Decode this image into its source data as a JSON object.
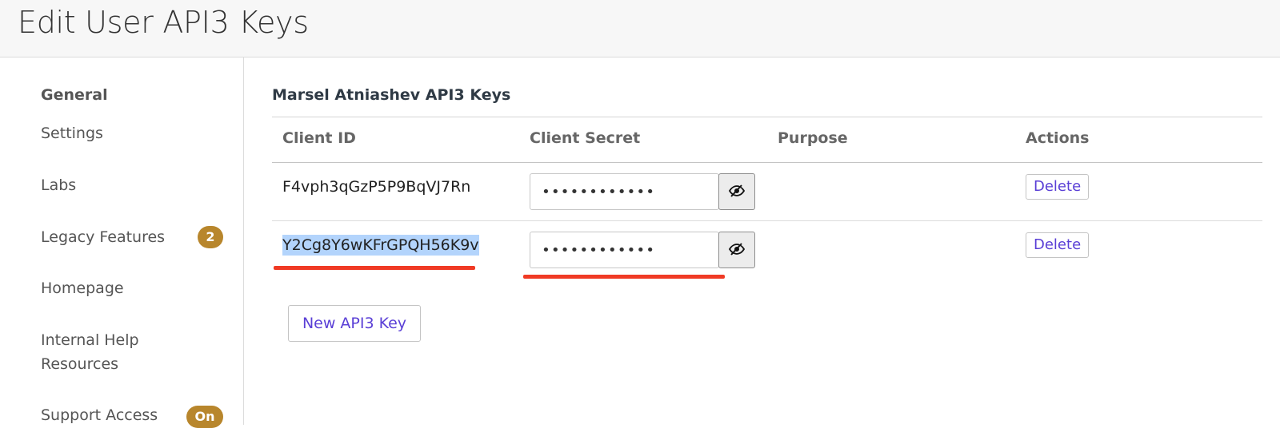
{
  "header": {
    "title": "Edit User API3 Keys"
  },
  "sidebar": {
    "heading": "General",
    "items": [
      {
        "label": "Settings"
      },
      {
        "label": "Labs"
      },
      {
        "label": "Legacy Features",
        "badge": "2"
      },
      {
        "label": "Homepage"
      },
      {
        "label": "Internal Help Resources"
      },
      {
        "label": "Support Access",
        "badge": "On"
      }
    ]
  },
  "main": {
    "section_title": "Marsel Atniashev API3 Keys",
    "columns": [
      "Client ID",
      "Client Secret",
      "Purpose",
      "Actions"
    ],
    "rows": [
      {
        "client_id": "F4vph3qGzP5P9BqVJ7Rn",
        "secret_masked": "••••••••••••",
        "purpose": "",
        "action": "Delete"
      },
      {
        "client_id": "Y2Cg8Y6wKFrGPQH56K9v",
        "secret_masked": "••••••••••••",
        "purpose": "",
        "action": "Delete"
      }
    ],
    "new_key_label": "New API3 Key"
  },
  "colors": {
    "accent": "#5a3fd6",
    "badge": "#b8862c",
    "annotation": "#f03a24",
    "selection": "#b3d4fc"
  },
  "icons": {
    "reveal": "eye-slash-icon"
  }
}
